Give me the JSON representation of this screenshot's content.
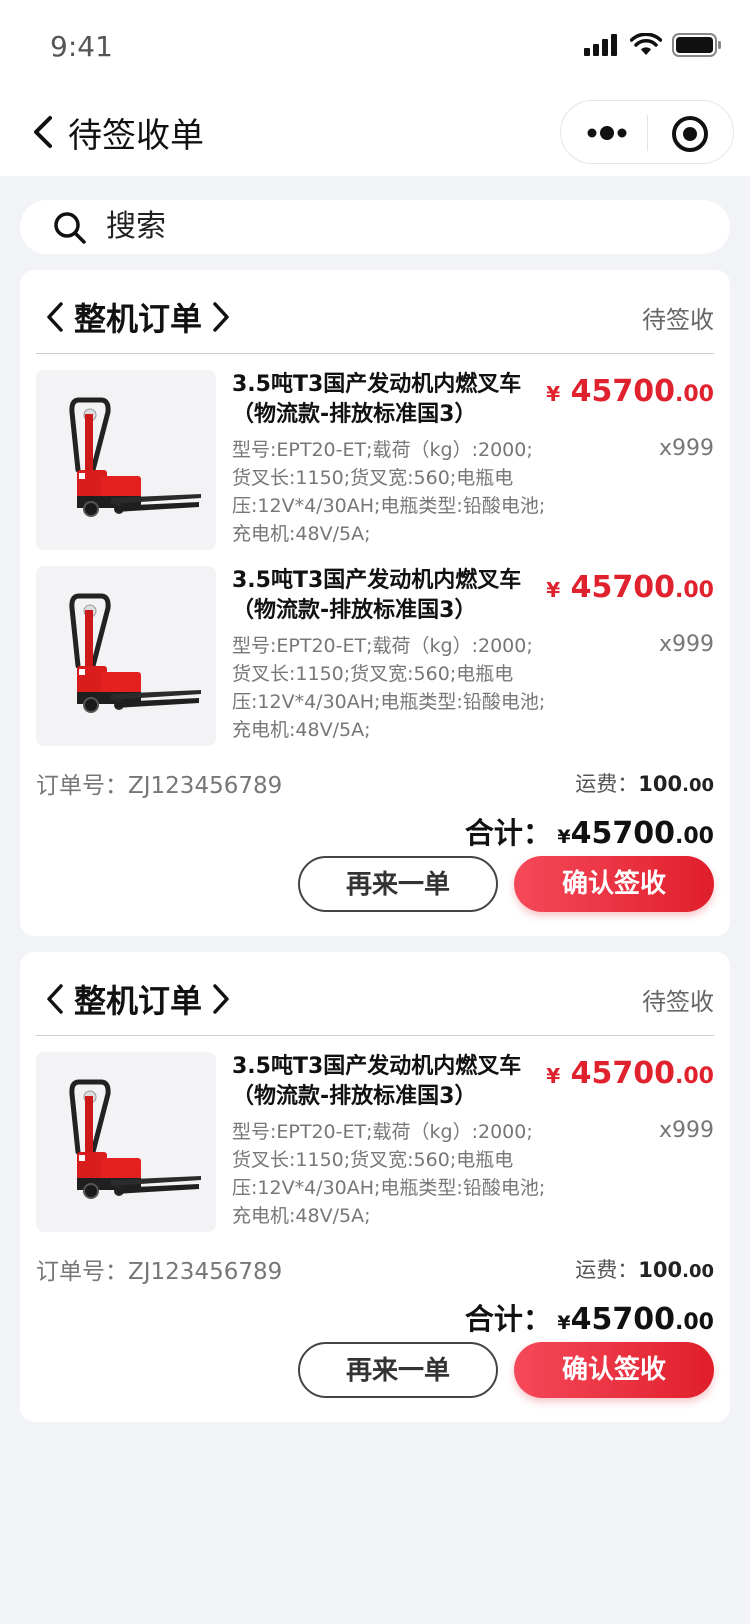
{
  "status_bar": {
    "time": "9:41"
  },
  "nav": {
    "title": "待签收单"
  },
  "search": {
    "placeholder": "搜索"
  },
  "orders": [
    {
      "category": "整机订单",
      "status": "待签收",
      "items": [
        {
          "name": "3.5吨T3国产发动机内燃叉车（物流款-排放标准国3）",
          "desc": "型号:EPT20-ET;载荷（kg）:2000;货叉长:1150;货叉宽:560;电瓶电压:12V*4/30AH;电瓶类型:铅酸电池;充电机:48V/5A;",
          "price_currency": "¥",
          "price_int": "45700",
          "price_dec": ".00",
          "qty": "x999"
        },
        {
          "name": "3.5吨T3国产发动机内燃叉车（物流款-排放标准国3）",
          "desc": "型号:EPT20-ET;载荷（kg）:2000;货叉长:1150;货叉宽:560;电瓶电压:12V*4/30AH;电瓶类型:铅酸电池;充电机:48V/5A;",
          "price_currency": "¥",
          "price_int": "45700",
          "price_dec": ".00",
          "qty": "x999"
        }
      ],
      "order_no": "订单号：ZJ123456789",
      "shipping_label": "运费：",
      "shipping_int": "100",
      "shipping_dec": ".00",
      "total_label": "合计：",
      "total_currency": "¥",
      "total_int": "45700",
      "total_dec": ".00",
      "reorder_label": "再来一单",
      "confirm_label": "确认签收"
    },
    {
      "category": "整机订单",
      "status": "待签收",
      "items": [
        {
          "name": "3.5吨T3国产发动机内燃叉车（物流款-排放标准国3）",
          "desc": "型号:EPT20-ET;载荷（kg）:2000;货叉长:1150;货叉宽:560;电瓶电压:12V*4/30AH;电瓶类型:铅酸电池;充电机:48V/5A;",
          "price_currency": "¥",
          "price_int": "45700",
          "price_dec": ".00",
          "qty": "x999"
        }
      ],
      "order_no": "订单号：ZJ123456789",
      "shipping_label": "运费：",
      "shipping_int": "100",
      "shipping_dec": ".00",
      "total_label": "合计：",
      "total_currency": "¥",
      "total_int": "45700",
      "total_dec": ".00",
      "reorder_label": "再来一单",
      "confirm_label": "确认签收"
    }
  ],
  "colors": {
    "accent": "#e0222e",
    "background": "#f2f3f7"
  }
}
